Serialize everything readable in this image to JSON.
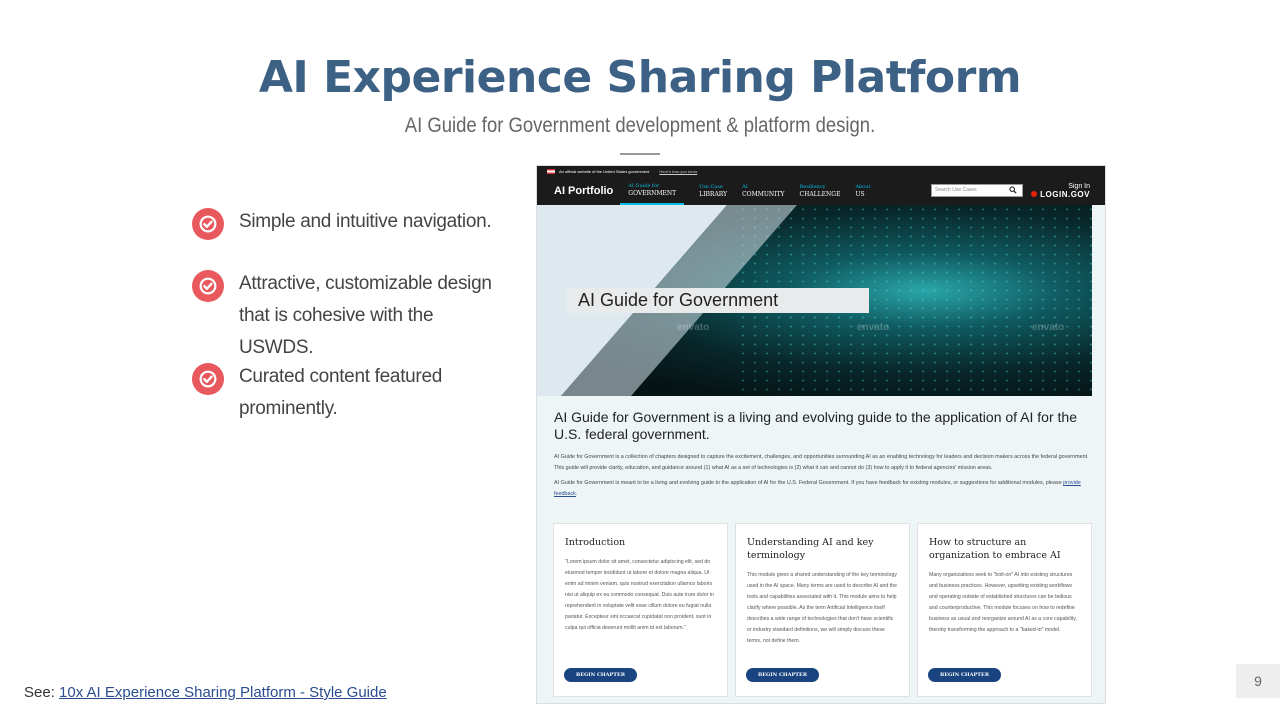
{
  "slide": {
    "title": "AI Experience Sharing Platform",
    "subtitle": "AI Guide for Government development & platform design.",
    "bullets": [
      {
        "icon": "check-circle-icon",
        "text": "Simple and intuitive navigation."
      },
      {
        "icon": "check-circle-icon",
        "text": "Attractive, customizable design that is cohesive with the USWDS."
      },
      {
        "icon": "check-circle-icon",
        "text": "Curated content featured prominently."
      }
    ],
    "footer": {
      "prefix": "See: ",
      "link_text": "10x AI Experience Sharing Platform - Style Guide"
    },
    "page_number": "9",
    "colors": {
      "title": "#3d6185",
      "check": "#e8585d",
      "nav": "#1b1b1b",
      "accent": "#00bde3",
      "button": "#1a4480"
    }
  },
  "screenshot": {
    "gov_banner": {
      "text": "An official website of the United States government",
      "link": "Here's how you know"
    },
    "nav": {
      "brand": "AI Portfolio",
      "items": [
        {
          "small": "AI Guide for",
          "main": "GOVERNMENT"
        },
        {
          "small": "Use Case",
          "main": "LIBRARY"
        },
        {
          "small": "AI",
          "main": "COMMUNITY"
        },
        {
          "small": "Resiliency",
          "main": "CHALLENGE"
        },
        {
          "small": "About",
          "main": "US"
        }
      ],
      "search_placeholder": "Search Use Cases",
      "sign_in": "Sign In",
      "login": "LOGIN.GOV"
    },
    "hero": {
      "label": "AI Guide for Government",
      "watermark": "envato"
    },
    "intro": {
      "heading": "AI Guide for Government is a living and evolving guide to the application of AI for the U.S. federal government.",
      "p1": "AI Guide for Government is a collection of chapters designed to capture the excitement, challenges, and opportunities surrounding AI as an enabling technology for leaders and decision makers across the federal government. This guide will provide clarity, education, and guidance around (1) what AI as a set of technologies is (2) what it can and cannot do (3) how to apply it to federal agencies' mission areas.",
      "p2": "AI Guide for Government is meant to be a living and evolving guide to the application of AI for the U.S. Federal Government. If you have feedback for existing modules, or suggestions for additional modules, please",
      "p2_link": "provide feedback",
      "p2_end": "."
    },
    "cards": [
      {
        "title": "Introduction",
        "body": "\"Lorem ipsum dolor sit amet, consectetur adipiscing elit, sed do eiusmod tempor incididunt ut labore et dolore magna aliqua. Ut enim ad minim veniam, quis nostrud exercitation ullamco laboris nisi ut aliquip ex ea commodo consequat. Duis aute irure dolor in reprehenderit in voluptate velit esse cillum dolore eu fugiat nulla pariatur. Excepteur sint occaecat cupidatat non proident, sunt in culpa qui officia deserunt mollit anim id est laborum.\"",
        "button": "BEGIN CHAPTER"
      },
      {
        "title": "Understanding AI and key terminology",
        "body": "This module gives a shared understanding of the key terminology used in the AI space. Many terms are used to describe AI and the tools and capabilities associated with it. This module aims to help clarify where possible. As the term Artificial Intelligence itself describes a wide range of technologies that don't have scientific or industry standard definitions, we will simply discuss these terms, not define them.",
        "button": "BEGIN CHAPTER"
      },
      {
        "title": "How to structure an organization to embrace AI",
        "body": "Many organizations seek to \"bolt-on\" AI into existing structures and business practices. However, upsetting existing workflows and operating outside of established structures can be tedious and counterproductive. This module focuses on how to redefine business as usual and reorganize around AI as a core capability, thereby transforming the approach to a \"baked-in\" model.",
        "button": "BEGIN CHAPTER"
      }
    ]
  }
}
